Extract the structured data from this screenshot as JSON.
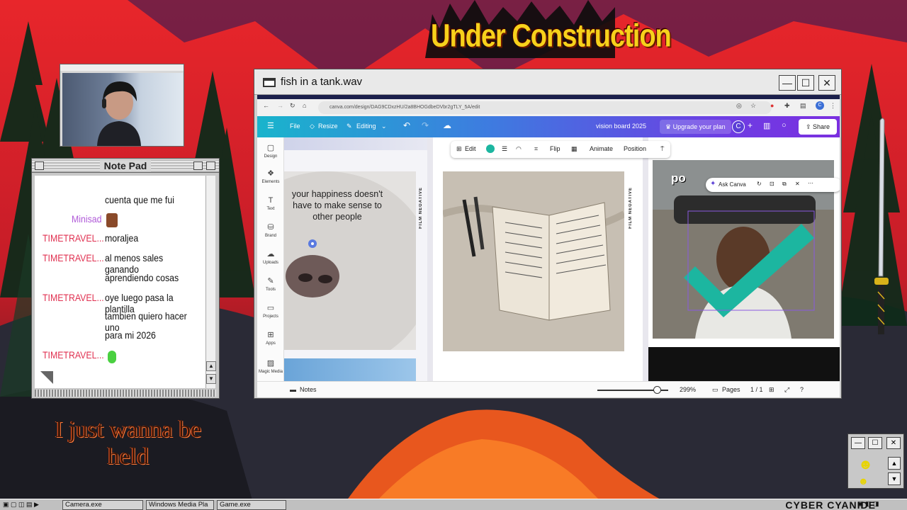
{
  "overlay": {
    "under_construction": "Under Construction",
    "wanna_held": "I just wanna be held",
    "branding": "CYBER CYANIDE"
  },
  "notepad": {
    "title": "Note Pad",
    "messages": [
      {
        "user": "",
        "text": "cuenta que me fui"
      },
      {
        "user": "Minisad",
        "text": ""
      },
      {
        "user": "TIMETRAVEL...",
        "text": "moraljea"
      },
      {
        "user": "TIMETRAVEL...",
        "text": "al menos sales ganando"
      },
      {
        "user": "",
        "text": "aprendiendo cosas"
      },
      {
        "user": "TIMETRAVEL...",
        "text": "oye luego pasa la plantilla"
      },
      {
        "user": "",
        "text": "tambien quiero hacer uno"
      },
      {
        "user": "",
        "text": "para mi 2026"
      },
      {
        "user": "TIMETRAVEL...",
        "text": ""
      }
    ]
  },
  "window": {
    "title": "fish in a tank.wav",
    "minimize": "—",
    "maximize": "☐",
    "close": "✕"
  },
  "browser": {
    "url": "canva.com/design/DAG9CDxzHU/2a8BHOGdbeDVbr2gTLY_5A/edit"
  },
  "canva": {
    "menu_file": "File",
    "menu_resize": "Resize",
    "menu_editing": "Editing",
    "doc_title": "vision board 2025",
    "upgrade": "Upgrade your plan",
    "avatar_letter": "C",
    "share": "Share",
    "sidebar": [
      {
        "label": "Design",
        "icon": "▢"
      },
      {
        "label": "Elements",
        "icon": "❖"
      },
      {
        "label": "Text",
        "icon": "T"
      },
      {
        "label": "Brand",
        "icon": "⛁"
      },
      {
        "label": "Uploads",
        "icon": "☁"
      },
      {
        "label": "Tools",
        "icon": "✎"
      },
      {
        "label": "Projects",
        "icon": "▭"
      },
      {
        "label": "Apps",
        "icon": "⊞"
      },
      {
        "label": "Magic Media",
        "icon": "▨"
      }
    ],
    "toolbar": {
      "edit": "Edit",
      "flip": "Flip",
      "animate": "Animate",
      "position": "Position"
    },
    "quote": "your happiness doesn't have to make sense to other people",
    "film_label": "FILM NEGATIVE",
    "ask_canva": "Ask Canva",
    "partial_text": "po",
    "notes": "Notes",
    "zoom": "299%",
    "pages_label": "Pages",
    "page_count": "1 / 1",
    "zoom_fraction": 0.84
  },
  "taskbar": {
    "items": [
      "Camera.exe",
      "Windows Media Pla",
      "Game.exe"
    ]
  },
  "colors": {
    "accent_check": "#1cb6a0",
    "canva_gradient_start": "#19b4cc",
    "canva_gradient_end": "#7b2fe0",
    "chat_user": "#e03050",
    "title_yellow": "#f7d11b"
  }
}
